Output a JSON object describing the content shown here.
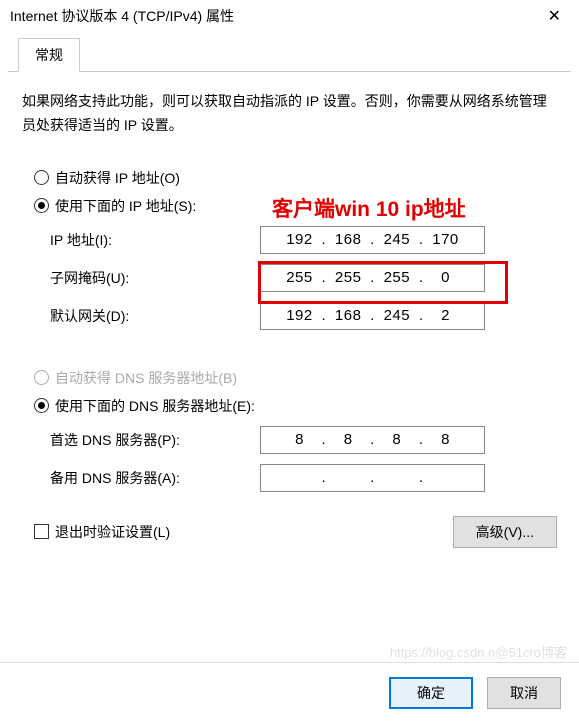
{
  "window": {
    "title": "Internet 协议版本 4 (TCP/IPv4) 属性",
    "close_glyph": "✕"
  },
  "tab": {
    "general": "常规"
  },
  "description": "如果网络支持此功能，则可以获取自动指派的 IP 设置。否则，你需要从网络系统管理员处获得适当的 IP 设置。",
  "ip_section": {
    "radio_auto": "自动获得 IP 地址(O)",
    "radio_manual": "使用下面的 IP 地址(S):",
    "ip_label": "IP 地址(I):",
    "ip_parts": [
      "192",
      "168",
      "245",
      "170"
    ],
    "mask_label": "子网掩码(U):",
    "mask_parts": [
      "255",
      "255",
      "255",
      "0"
    ],
    "gateway_label": "默认网关(D):",
    "gateway_parts": [
      "192",
      "168",
      "245",
      "2"
    ]
  },
  "dns_section": {
    "radio_auto": "自动获得 DNS 服务器地址(B)",
    "radio_manual": "使用下面的 DNS 服务器地址(E):",
    "preferred_label": "首选 DNS 服务器(P):",
    "preferred_parts": [
      "8",
      "8",
      "8",
      "8"
    ],
    "alt_label": "备用 DNS 服务器(A):",
    "alt_parts": [
      "",
      "",
      "",
      ""
    ]
  },
  "validate_checkbox": "退出时验证设置(L)",
  "buttons": {
    "advanced": "高级(V)...",
    "ok": "确定",
    "cancel": "取消"
  },
  "annotation": "客户端win 10 ip地址",
  "watermark": "https://blog.csdn.n@51cro博客"
}
